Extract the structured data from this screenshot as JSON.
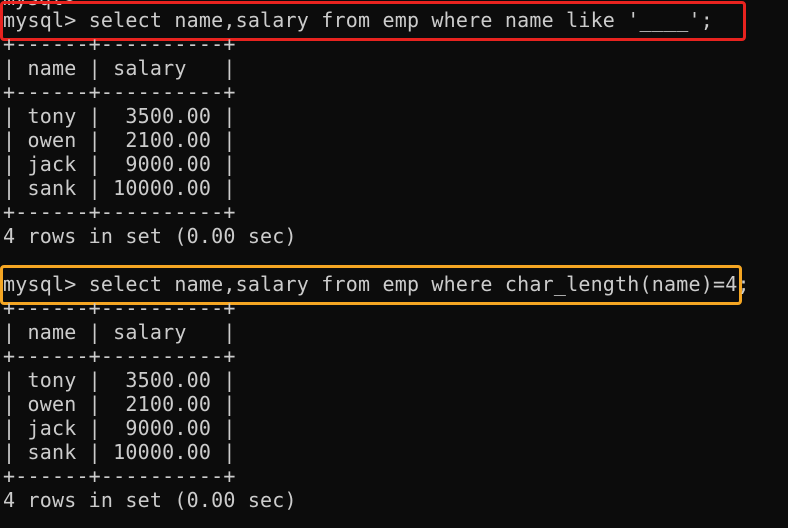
{
  "terminal": {
    "background": "#0c0c0c",
    "foreground": "#cccccc",
    "clipped_top_line": "mysql>",
    "highlight_colors": {
      "first_query": "#e8231f",
      "second_query": "#f5a623"
    },
    "query1": {
      "prompt": "mysql> ",
      "command": "select name,salary from emp where name like '____';",
      "border_top": "+------+----------+",
      "header": "| name | salary   |",
      "border_mid": "+------+----------+",
      "rows": [
        "| tony |  3500.00 |",
        "| owen |  2100.00 |",
        "| jack |  9000.00 |",
        "| sank | 10000.00 |"
      ],
      "border_bottom": "+------+----------+",
      "result": "4 rows in set (0.00 sec)"
    },
    "query2": {
      "prompt": "mysql> ",
      "command": "select name,salary from emp where char_length(name)=4;",
      "border_top": "+------+----------+",
      "header": "| name | salary   |",
      "border_mid": "+------+----------+",
      "rows": [
        "| tony |  3500.00 |",
        "| owen |  2100.00 |",
        "| jack |  9000.00 |",
        "| sank | 10000.00 |"
      ],
      "border_bottom": "+------+----------+",
      "result": "4 rows in set (0.00 sec)"
    }
  }
}
